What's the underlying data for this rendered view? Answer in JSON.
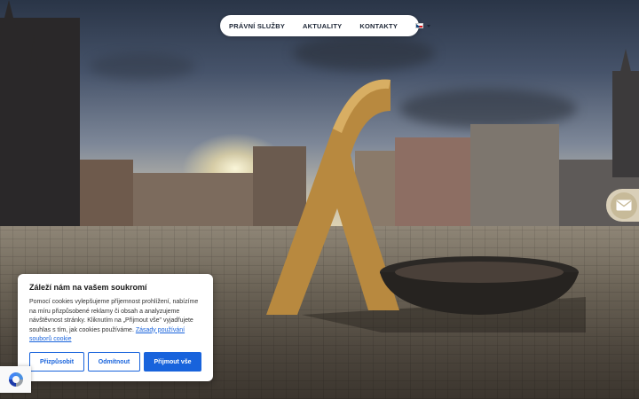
{
  "nav": {
    "items": [
      "PRÁVNÍ SLUŽBY",
      "AKTUALITY",
      "KONTAKTY"
    ],
    "lang_icon": "czech-flag-icon"
  },
  "contact": {
    "icon": "mail-icon"
  },
  "cookie": {
    "title": "Záleží nám na vašem soukromí",
    "body": "Pomocí cookies vylepšujeme příjemnost prohlížení, nabízíme na míru přizpůsobené reklamy či obsah a analyzujeme návštěvnost stránky. Kliknutím na „Přijmout vše\" vyjadřujete souhlas s tím, jak cookies používáme. ",
    "link": "Zásady používání souborů cookie",
    "customize": "Přizpůsobit",
    "reject": "Odmítnout",
    "accept": "Přijmout vše"
  },
  "colors": {
    "accent": "#1863dc",
    "sculpture": "#b8893f",
    "contact_button": "#d9cfb8"
  },
  "recaptcha": {
    "icon": "recaptcha-icon"
  }
}
